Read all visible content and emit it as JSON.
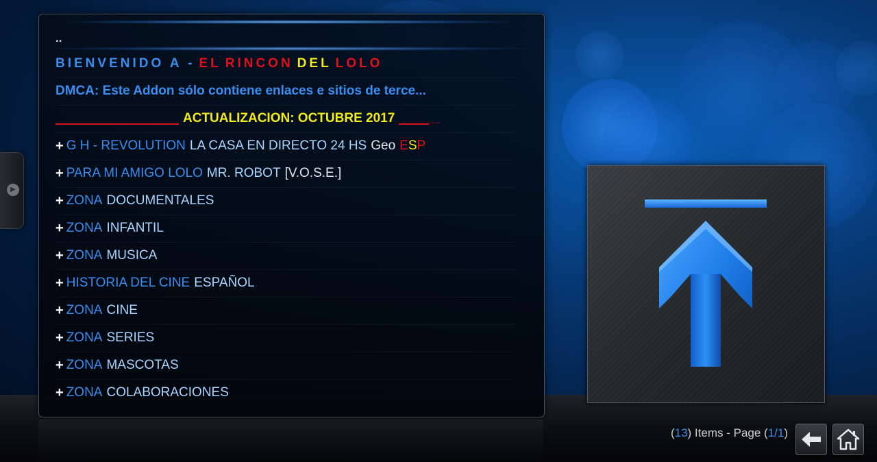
{
  "list": {
    "parent_label": "..",
    "welcome": {
      "prefix": "BIENVENIDO A -",
      "el": "EL",
      "rincon": "RINCON",
      "del": "DEL",
      "lolo": "LOLO"
    },
    "dmca": "DMCA: Este Addon sólo contiene enlaces e sitios de terce...",
    "update": {
      "label": "ACTUALIZACION: OCTUBRE 2017",
      "tail": "....."
    },
    "items": [
      {
        "plus": "+",
        "part1": "G H - REVOLUTION",
        "part2": "LA CASA EN DIRECTO 24 HS",
        "part3": "Geo",
        "part4": "E",
        "part5": "S",
        "part6": "P"
      },
      {
        "plus": "+",
        "part1": "PARA MI AMIGO LOLO",
        "part2": "MR. ROBOT",
        "part3": "[V.O.S.E.]"
      },
      {
        "plus": "+",
        "part1": "ZONA",
        "part2": "DOCUMENTALES"
      },
      {
        "plus": "+",
        "part1": "ZONA",
        "part2": "INFANTIL"
      },
      {
        "plus": "+",
        "part1": "ZONA",
        "part2": "MUSICA"
      },
      {
        "plus": "+",
        "part1": "HISTORIA DEL CINE",
        "part2": "ESPAÑOL"
      },
      {
        "plus": "+",
        "part1": "ZONA",
        "part2": "CINE"
      },
      {
        "plus": "+",
        "part1": "ZONA",
        "part2": "SERIES"
      },
      {
        "plus": "+",
        "part1": "ZONA",
        "part2": "MASCOTAS"
      },
      {
        "plus": "+",
        "part1": "ZONA",
        "part2": "COLABORACIONES"
      }
    ]
  },
  "thumbnail": {
    "icon": "up-arrow-icon"
  },
  "footer": {
    "open_paren": "(",
    "count": "13",
    "items_text": ") Items - Page (",
    "page": "1/1",
    "close_paren": ")"
  },
  "buttons": {
    "back_icon": "back-arrow-icon",
    "home_icon": "home-icon"
  },
  "side_tab": {
    "icon": "play-circle-icon",
    "glyph": "▶"
  },
  "colors": {
    "accent_blue": "#3a8ef0",
    "red": "#e2101a",
    "yellow": "#f3ec1b"
  }
}
